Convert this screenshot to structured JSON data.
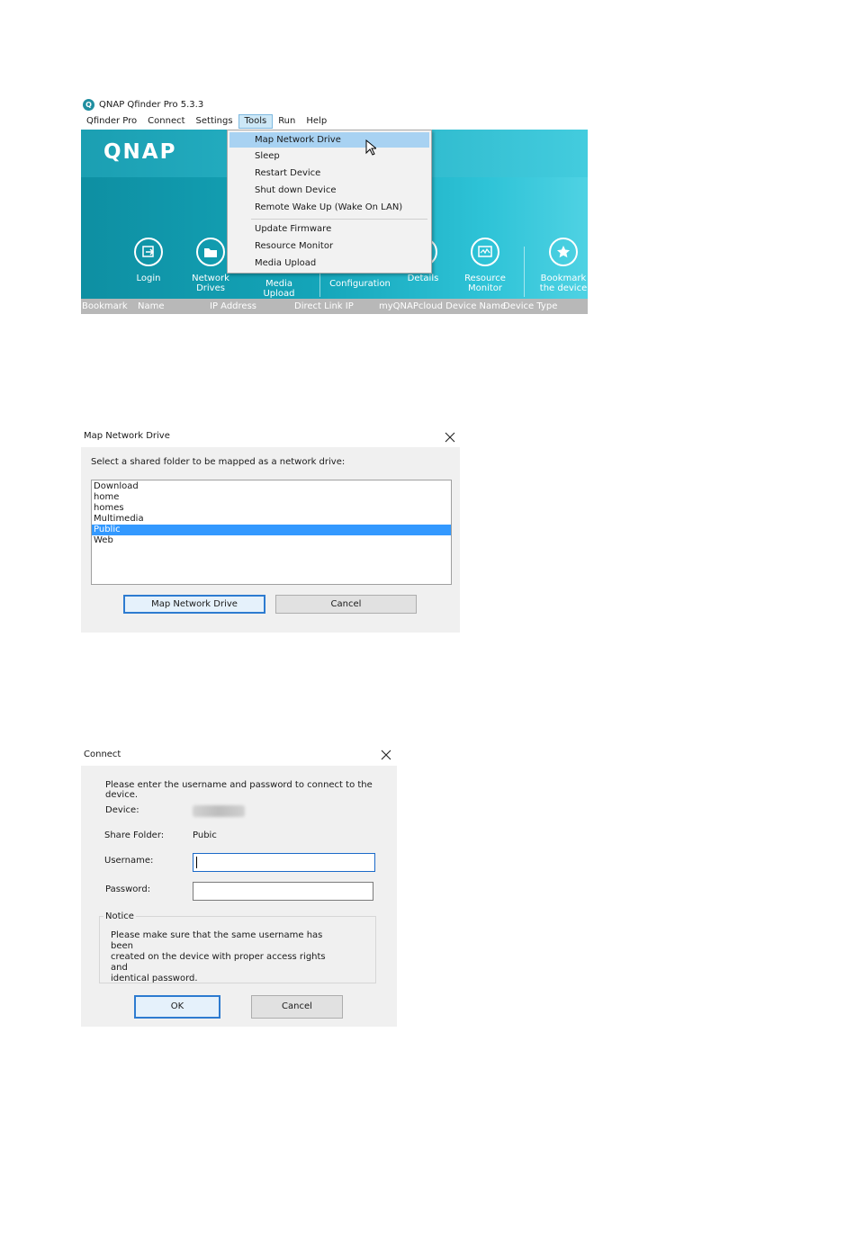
{
  "qfinder": {
    "title": "QNAP Qfinder Pro 5.3.3",
    "menu": [
      "Qfinder Pro",
      "Connect",
      "Settings",
      "Tools",
      "Run",
      "Help"
    ],
    "logo": "QNAP",
    "tools": {
      "login": "Login",
      "network_drives": [
        "Network",
        "Drives"
      ],
      "media_upload": "Media Upload",
      "configuration": "Configuration",
      "details": "Details",
      "resource_monitor": [
        "Resource",
        "Monitor"
      ],
      "bookmark": [
        "Bookmark",
        "the device"
      ]
    },
    "columns": [
      "Bookmark",
      "Name",
      "IP Address",
      "Direct Link IP",
      "myQNAPcloud Device Name",
      "Device Type"
    ],
    "tools_menu": {
      "items": [
        "Map Network Drive",
        "Sleep",
        "Restart Device",
        "Shut down Device",
        "Remote Wake Up (Wake On LAN)"
      ],
      "items2": [
        "Update Firmware",
        "Resource Monitor",
        "Media Upload"
      ],
      "highlighted": "Map Network Drive"
    }
  },
  "map_drive_dialog": {
    "title": "Map Network Drive",
    "prompt": "Select a shared folder to be mapped as a network drive:",
    "folders": [
      "Download",
      "home",
      "homes",
      "Multimedia",
      "Public",
      "Web"
    ],
    "selected": "Public",
    "map_button": "Map Network Drive",
    "cancel_button": "Cancel"
  },
  "connect_dialog": {
    "title": "Connect",
    "instruction_line1": "Please enter the username and password to connect to the",
    "instruction_line2": "device.",
    "device_label": "Device:",
    "share_label": "Share Folder:",
    "share_value": "Pubic",
    "username_label": "Username:",
    "username_value": "",
    "password_label": "Password:",
    "password_value": "",
    "notice_title": "Notice",
    "notice_lines": [
      "Please make sure that the same username has been",
      "created on the device with proper access rights and",
      "identical password."
    ],
    "ok_button": "OK",
    "cancel_button": "Cancel"
  }
}
